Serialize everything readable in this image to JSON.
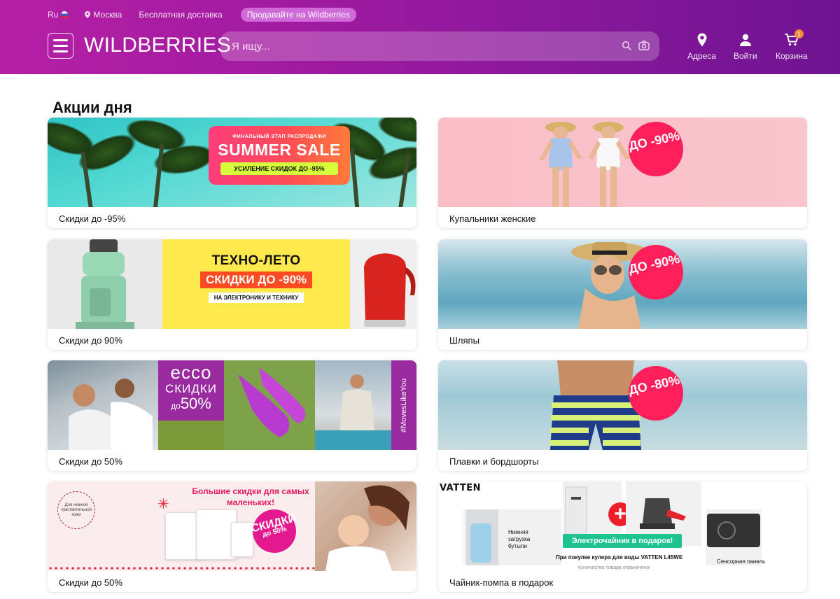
{
  "topbar": {
    "lang": "Ru",
    "city": "Москва",
    "delivery": "Бесплатная доставка",
    "sell_button": "Продавайте на Wildberries"
  },
  "header": {
    "logo": "WILDBERRIES",
    "search_placeholder": "Я ищу...",
    "nav": {
      "addresses": "Адреса",
      "login": "Войти",
      "cart": "Корзина",
      "cart_count": "1"
    }
  },
  "colors": {
    "header_start": "#b51fa5",
    "header_end": "#6e1493",
    "cart_badge": "#f58a3a"
  },
  "main": {
    "title": "Акции дня",
    "cards": [
      {
        "caption": "Скидки до -95%",
        "banner": {
          "kicker": "ФИНАЛЬНЫЙ ЭТАП РАСПРОДАЖИ",
          "headline": "SUMMER SALE",
          "strip": "УСИЛЕНИЕ СКИДОК ДО -95%"
        }
      },
      {
        "caption": "Купальники женские",
        "banner": {
          "badge": "ДО -90%"
        }
      },
      {
        "caption": "Скидки до 90%",
        "banner": {
          "line1": "ТЕХНО-ЛЕТО",
          "line2": "СКИДКИ ДО -90%",
          "line3": "НА ЭЛЕКТРОНИКУ И ТЕХНИКУ"
        }
      },
      {
        "caption": "Шляпы",
        "banner": {
          "badge": "ДО -90%"
        }
      },
      {
        "caption": "Скидки до 50%",
        "banner": {
          "brand": "ecco",
          "line1": "СКИДКИ",
          "line2_prefix": "до",
          "line2": "50%",
          "hashtag": "#MovesLikeYou"
        }
      },
      {
        "caption": "Плавки и бордшорты",
        "banner": {
          "badge": "ДО -80%"
        }
      },
      {
        "caption": "Скидки до 50%",
        "banner": {
          "title": "Большие скидки для самых маленьких!",
          "circle_text": "Для нежной чувствительной кожи",
          "badge_top": "СКИДКИ",
          "badge_bottom": "до 50%"
        }
      },
      {
        "caption": "Чайник-помпа в подарок",
        "banner": {
          "brand": "VATTEN",
          "label_left": "Нижняя загрузка бутыли",
          "green": "Электрочайник в подарок!",
          "bottom": "При покупке кулера для воды VATTEN L45WE",
          "right_label": "Сенсорная панель",
          "note": "Количество товара ограничено!"
        }
      }
    ]
  }
}
